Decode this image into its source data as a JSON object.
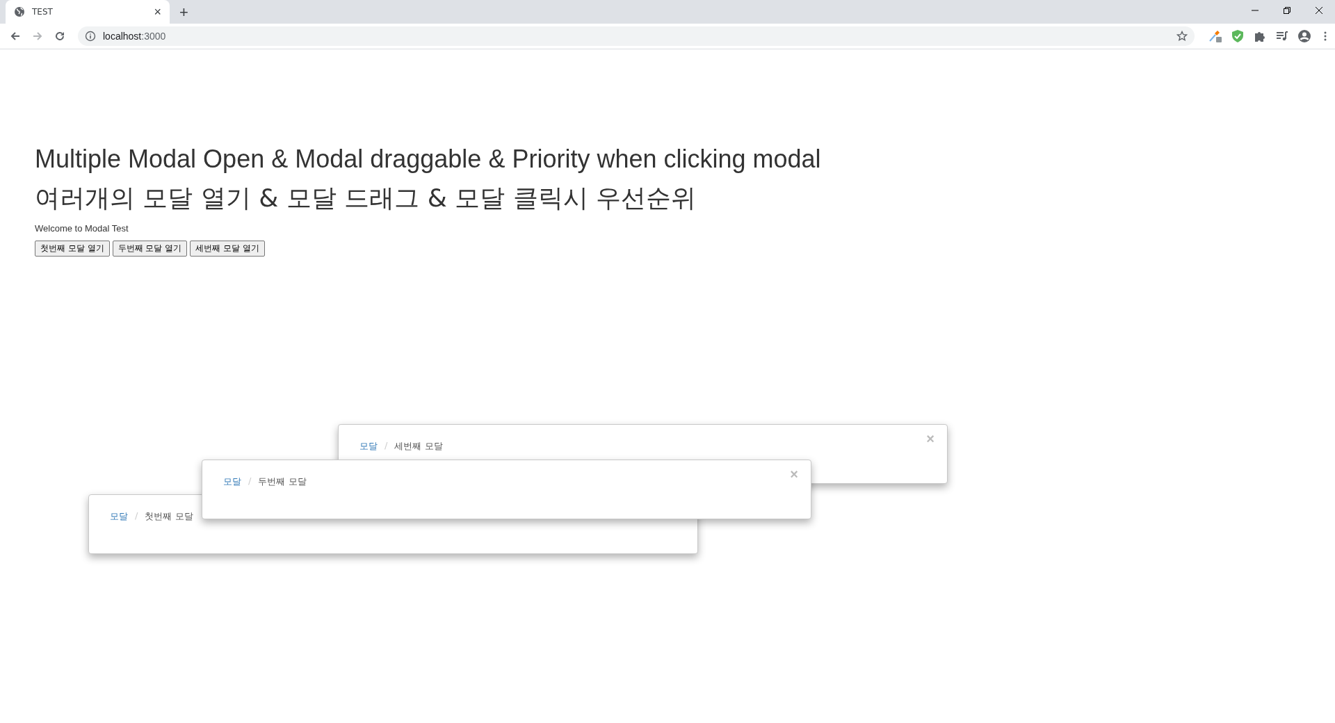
{
  "browser": {
    "tab": {
      "title": "TEST",
      "close": "×",
      "selected": true
    },
    "new_tab": "+",
    "address": {
      "host": "localhost",
      "port": ":3000"
    }
  },
  "page": {
    "heading": "Multiple Modal Open & Modal draggable & Priority when clicking modal",
    "heading_ko": "여러개의 모달 열기 & 모달 드래그 & 모달 클릭시 우선순위",
    "welcome": "Welcome to Modal Test",
    "buttons": [
      "첫번째 모달 열기",
      "두번째 모달 열기",
      "세번째 모달 열기"
    ]
  },
  "modals": [
    {
      "breadcrumb": "모달",
      "separator": "/",
      "title": "첫번째 모달"
    },
    {
      "breadcrumb": "모달",
      "separator": "/",
      "title": "세번째 모달",
      "close": "×"
    },
    {
      "breadcrumb": "모달",
      "separator": "/",
      "title": "두번째 모달",
      "close": "×"
    }
  ]
}
